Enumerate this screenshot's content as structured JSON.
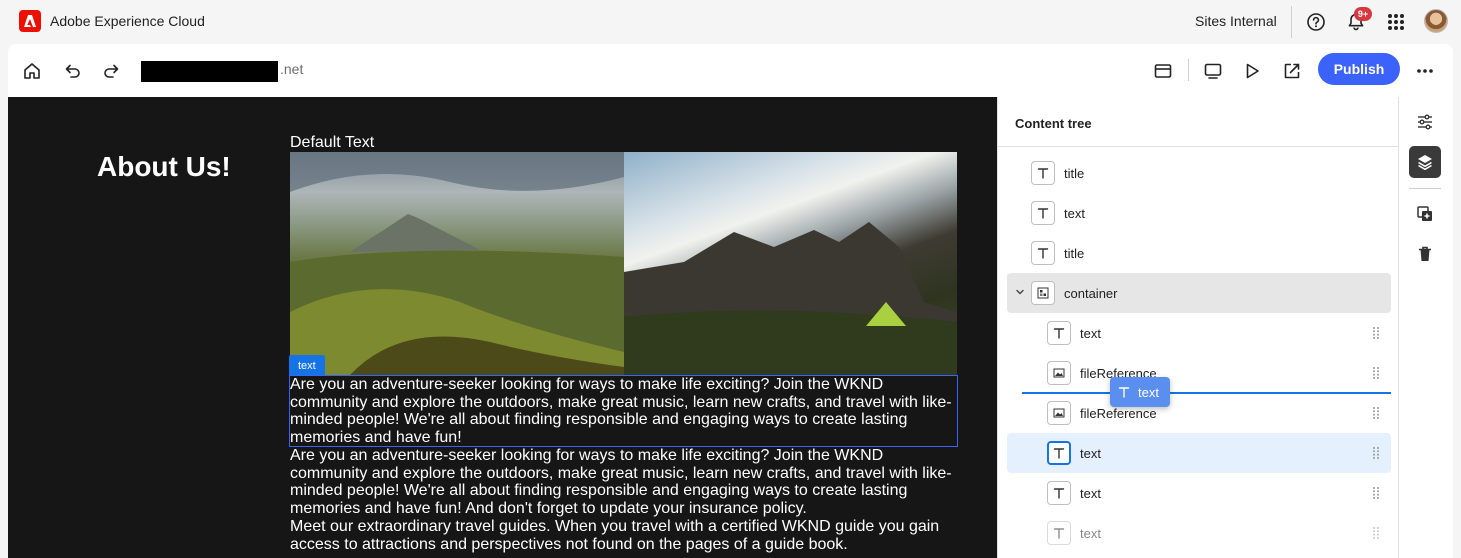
{
  "shell": {
    "brand": "Adobe Experience Cloud",
    "environment": "Sites Internal",
    "notification_badge": "9+",
    "icons": [
      "help-icon",
      "bell-icon",
      "app-grid-icon"
    ]
  },
  "toolbar": {
    "domain_suffix": ".net",
    "publish_label": "Publish",
    "icons": [
      "home-icon",
      "undo-icon",
      "redo-icon",
      "properties-icon",
      "device-preview-icon",
      "preview-icon",
      "open-external-icon",
      "more-icon"
    ]
  },
  "canvas": {
    "heading": "About Us!",
    "default_text": "Default Text",
    "selection_label": "text",
    "paragraphs": [
      "Are you an adventure-seeker looking for ways to make life exciting? Join the WKND community and explore the outdoors, make great music, learn new crafts, and travel with like-minded people! We're all about finding responsible and engaging ways to create lasting memories and have fun!",
      "Are you an adventure-seeker looking for ways to make life exciting? Join the WKND community and explore the outdoors, make great music, learn new crafts, and travel with like-minded people! We're all about finding responsible and engaging ways to create lasting memories and have fun! And don't forget to update your insurance policy.",
      "Meet our extraordinary travel guides. When you travel with a certified WKND guide you gain access to attractions and perspectives not found on the pages of a guide book."
    ]
  },
  "content_tree": {
    "title": "Content tree",
    "nodes": [
      {
        "label": "title",
        "icon": "text-icon"
      },
      {
        "label": "text",
        "icon": "text-icon"
      },
      {
        "label": "title",
        "icon": "text-icon"
      },
      {
        "label": "container",
        "icon": "container-icon",
        "expanded": true,
        "selected": true
      },
      {
        "label": "text",
        "icon": "text-icon"
      },
      {
        "label": "fileReference",
        "icon": "image-icon"
      },
      {
        "label": "fileReference",
        "icon": "image-icon"
      },
      {
        "label": "text",
        "icon": "text-icon",
        "highlighted": true
      },
      {
        "label": "text",
        "icon": "text-icon"
      },
      {
        "label": "text",
        "icon": "text-icon",
        "faded": true
      }
    ],
    "drag_chip_label": "text"
  },
  "rail": {
    "icons": [
      "adjustments-icon",
      "layers-icon",
      "add-component-icon",
      "delete-icon"
    ]
  },
  "colors": {
    "accent": "#3b63fb",
    "selection": "#1473e6",
    "canvas_bg": "#161616",
    "adobe_red": "#eb1000"
  }
}
